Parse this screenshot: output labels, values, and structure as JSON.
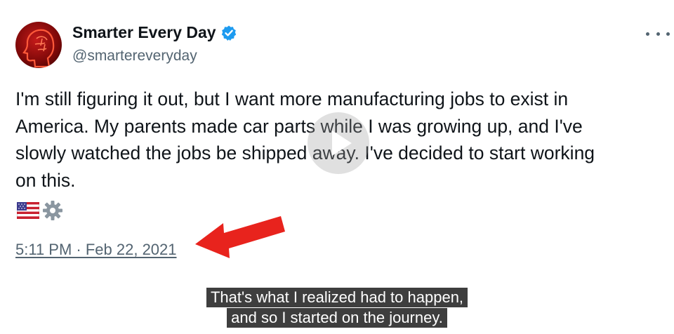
{
  "account": {
    "name": "Smarter Every Day",
    "handle": "@smartereveryday",
    "verified_color": "#1d9bf0"
  },
  "icons": {
    "avatar": "head-profile-avatar",
    "verified": "verified-badge-icon",
    "more": "more-options-icon",
    "play": "play-icon",
    "flag": "us-flag-icon",
    "gear": "gear-icon",
    "arrow": "red-arrow-icon"
  },
  "tweet": {
    "lines": [
      "I'm still figuring it out, but I want more manufacturing jobs to exist in",
      "America. My parents made car parts while I was growing up, and I've",
      "slowly watched the jobs be shipped away. I've decided to start working",
      "on this."
    ],
    "timestamp": "5:11 PM · Feb 22, 2021"
  },
  "captions": {
    "line1": "That's what I realized had to happen,",
    "line2": "and so I started on the journey."
  },
  "colors": {
    "text": "#0f1419",
    "secondary": "#536471",
    "arrow": "#e8231d",
    "avatar_red": "#c41a1a"
  }
}
